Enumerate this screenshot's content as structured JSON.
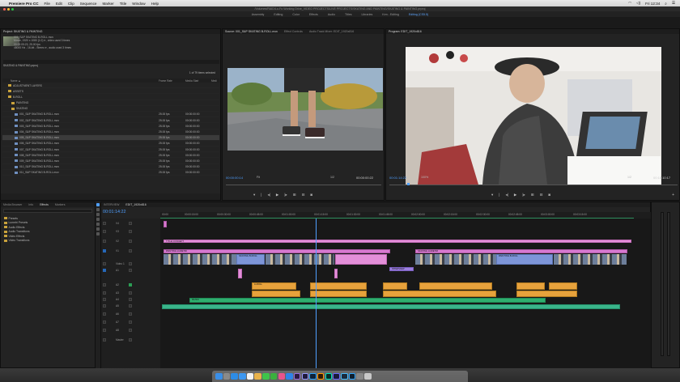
{
  "menubar": {
    "app_name": "Premiere Pro CC",
    "items": [
      "File",
      "Edit",
      "Clip",
      "Sequence",
      "Marker",
      "Title",
      "Window",
      "Help"
    ],
    "clock": "Fri 12:34"
  },
  "window": {
    "title": "/Volumes/RAID/Lo-Fo Working Drive_VIDEO PROJECTS/LIVE PROJECTS/SKATING AND PAINTING/SKATING & PAINTING.prproj"
  },
  "workspaces": {
    "tabs": [
      "Assembly",
      "Editing",
      "Color",
      "Effects",
      "Audio",
      "Titles",
      "Libraries",
      "Ken - Editing",
      "Editing (CS5.5)"
    ],
    "active": "Editing (CS5.5)"
  },
  "project": {
    "tab": "Project: SKATING & PAINTING",
    "clip_name": "001_S&P SKATING B-ROLL.mov",
    "clip_line1": "Movie, 1920 x 1080 (1.0) ▾ , video used 3 times",
    "clip_line2": "00:00:05:23, 25.00 fps",
    "clip_line3": "48000 Hz - 16-bit - Stereo ▾ , audio used 3 times",
    "project_file": "SKATING & PAINTING.prproj",
    "count": "1 of 79 items selected",
    "columns": {
      "name": "Name ▲",
      "frame_rate": "Frame Rate",
      "media_start": "Media Start",
      "media": "Medi"
    },
    "rows": [
      {
        "name": "ADJUSTMENT LAYERS",
        "type": "folder",
        "indent": 1,
        "fps": "",
        "start": ""
      },
      {
        "name": "ASSETS",
        "type": "folder",
        "indent": 1,
        "fps": "",
        "start": ""
      },
      {
        "name": "B-ROLL",
        "type": "folder",
        "indent": 1,
        "fps": "",
        "start": ""
      },
      {
        "name": "PAINTING",
        "type": "folder",
        "indent": 2,
        "fps": "",
        "start": ""
      },
      {
        "name": "SKATING",
        "type": "folder",
        "indent": 2,
        "fps": "",
        "start": ""
      },
      {
        "name": "001_S&P SKATING B-ROLL.mov",
        "type": "clip",
        "indent": 3,
        "fps": "25.00 fps",
        "start": "00:00:00:00"
      },
      {
        "name": "002_S&P SKATING B-ROLL.mov",
        "type": "clip",
        "indent": 3,
        "fps": "25.00 fps",
        "start": "00:00:00:00"
      },
      {
        "name": "003_S&P SKATING B-ROLL.mov",
        "type": "clip",
        "indent": 3,
        "fps": "25.00 fps",
        "start": "00:00:00:00"
      },
      {
        "name": "004_S&P SKATING B-ROLL.mov",
        "type": "clip",
        "indent": 3,
        "fps": "25.00 fps",
        "start": "00:00:00:00"
      },
      {
        "name": "005_S&P SKATING B-ROLL.mov",
        "type": "clip",
        "indent": 3,
        "fps": "25.00 fps",
        "start": "00:00:00:00",
        "selected": true
      },
      {
        "name": "006_S&P SKATING B-ROLL.mov",
        "type": "clip",
        "indent": 3,
        "fps": "25.00 fps",
        "start": "00:00:00:00"
      },
      {
        "name": "007_S&P SKATING B-ROLL.mov",
        "type": "clip",
        "indent": 3,
        "fps": "25.00 fps",
        "start": "00:00:00:00"
      },
      {
        "name": "008_S&P SKATING B-ROLL.mov",
        "type": "clip",
        "indent": 3,
        "fps": "25.00 fps",
        "start": "00:00:00:00"
      },
      {
        "name": "009_S&P SKATING B-ROLL.mov",
        "type": "clip",
        "indent": 3,
        "fps": "25.00 fps",
        "start": "00:00:00:00"
      },
      {
        "name": "010_S&P SKATING B-ROLL.mov",
        "type": "clip",
        "indent": 3,
        "fps": "25.00 fps",
        "start": "00:00:00:00"
      },
      {
        "name": "011_S&P SKATING B-ROLL.mov",
        "type": "clip",
        "indent": 3,
        "fps": "25.00 fps",
        "start": "00:00:00:00"
      }
    ]
  },
  "source": {
    "tabs": [
      "Source: 001_S&P SKATING B-ROLL.mov",
      "Effect Controls",
      "Audio Track Mixer: EDIT_1920x816"
    ],
    "timecode": "00:00:00:14",
    "fit": "Fit",
    "quality": "1/2",
    "duration": "00:00:00:22"
  },
  "program": {
    "tab": "Program: EDIT_1920x816",
    "timecode": "00:01:14:22",
    "zoom": "100%",
    "quality": "1/2",
    "duration": "00:18:10:17"
  },
  "effects": {
    "tabs": [
      "Media Browser",
      "Info",
      "Effects",
      "Markers"
    ],
    "items": [
      "Presets",
      "Lumetri Presets",
      "Audio Effects",
      "Audio Transitions",
      "Video Effects",
      "Video Transitions"
    ]
  },
  "timeline": {
    "tabs": [
      "INTERVIEW",
      "EDIT_1920x816"
    ],
    "timecode": "00:01:14:22",
    "ruler": [
      "00:00",
      "00:00:15:00",
      "00:00:30:00",
      "00:00:45:00",
      "00:01:00:00",
      "00:01:15:00",
      "00:01:30:00",
      "00:01:45:00",
      "00:02:00:00",
      "00:02:15:00",
      "00:02:30:00",
      "00:02:45:00",
      "00:03:00:00",
      "00:03:15:00"
    ],
    "tracks": [
      "V4",
      "V3",
      "V2",
      "V1",
      "Video 1",
      "A1",
      "A2",
      "A3",
      "A4",
      "A5",
      "A6",
      "A7",
      "A8",
      "Master"
    ],
    "master_value": "0.0",
    "clip_labels": {
      "title": "TITLE CONCEPT",
      "title2": "TITLE CONCEPT",
      "lumetri": "PAINTING LUMETRI",
      "lumetri2": "SKATING LUMETRI",
      "skate": "SKATING B-ROLL",
      "paint": "PAINTING B-ROLL",
      "interview": "INTERVIEW",
      "audio": "A-ROLL",
      "music": "MUSIC"
    }
  },
  "dock": {
    "apps": [
      "finder",
      "launchpad",
      "safari",
      "mail",
      "calendar",
      "photos",
      "messages",
      "facetime",
      "itunes",
      "appstore",
      "premiere",
      "aftereffects",
      "photoshop",
      "illustrator",
      "audition",
      "mediaencoder",
      "prelude",
      "lightroom",
      "preferences",
      "trash"
    ]
  }
}
